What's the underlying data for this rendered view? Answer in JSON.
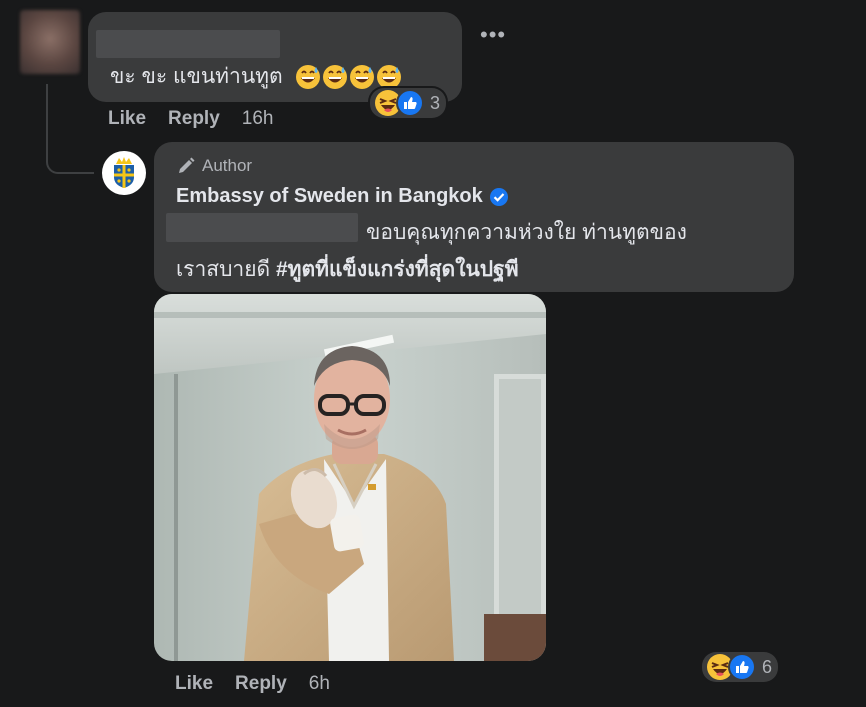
{
  "comment1": {
    "text": "ขะ ขะ แขนท่านทูต",
    "emoji_icons": [
      "grinning-sweat-icon",
      "grinning-sweat-icon",
      "grinning-sweat-icon",
      "grinning-sweat-icon"
    ],
    "reaction_count": "3",
    "actions": {
      "like": "Like",
      "reply": "Reply",
      "time": "16h"
    }
  },
  "reply": {
    "author_badge": "Author",
    "author_name": "Embassy of Sweden in Bangkok",
    "text_line1": "ขอบคุณทุกความห่วงใย ท่านทูตของ",
    "text_line2_plain": "เราสบายดี ",
    "hashtag": "#ทูตที่แข็งแกร่งที่สุดในปฐพี",
    "reaction_count": "6",
    "actions": {
      "like": "Like",
      "reply": "Reply",
      "time": "6h"
    }
  },
  "colors": {
    "background": "#18191a",
    "bubble": "#3a3b3c",
    "text_primary": "#e4e6eb",
    "text_secondary": "#b0b3b8",
    "verified_blue": "#1877f2"
  }
}
